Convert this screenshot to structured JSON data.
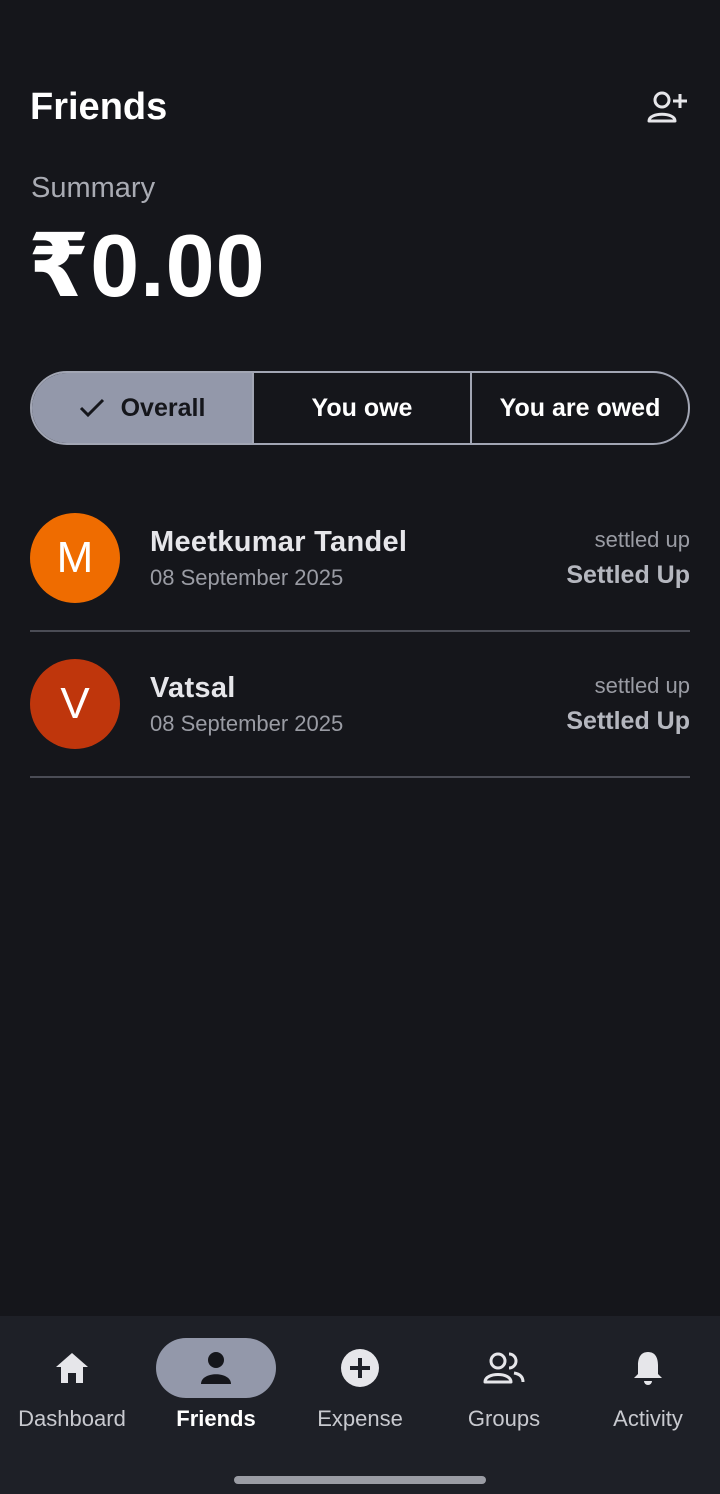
{
  "header": {
    "title": "Friends",
    "add_icon": "person-add-icon"
  },
  "summary": {
    "label": "Summary",
    "amount": "₹0.00"
  },
  "filters": {
    "overall": "Overall",
    "you_owe": "You owe",
    "you_are_owed": "You are owed",
    "selected": "Overall"
  },
  "friends": [
    {
      "initial": "M",
      "name": "Meetkumar Tandel",
      "date": "08 September 2025",
      "status_small": "settled up",
      "status_big": "Settled Up",
      "avatar_color": "#ef6c00"
    },
    {
      "initial": "V",
      "name": "Vatsal",
      "date": "08 September 2025",
      "status_small": "settled up",
      "status_big": "Settled Up",
      "avatar_color": "#bf360c"
    }
  ],
  "nav": [
    {
      "label": "Dashboard",
      "icon": "home-icon"
    },
    {
      "label": "Friends",
      "icon": "person-icon"
    },
    {
      "label": "Expense",
      "icon": "plus-circle-icon"
    },
    {
      "label": "Groups",
      "icon": "group-icon"
    },
    {
      "label": "Activity",
      "icon": "bell-icon"
    }
  ],
  "colors": {
    "background": "#15161b",
    "accent": "#9398aa",
    "nav_background": "#1e2027"
  }
}
